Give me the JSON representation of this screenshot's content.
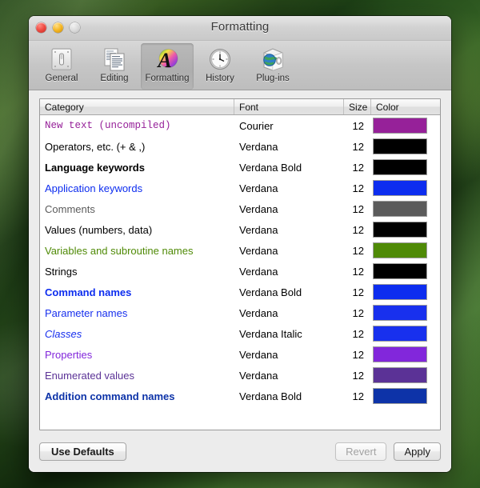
{
  "window": {
    "title": "Formatting",
    "traffic_lights": [
      "close",
      "minimize",
      "zoom"
    ]
  },
  "toolbar": {
    "items": [
      {
        "label": "General",
        "icon": "switch-icon",
        "selected": false
      },
      {
        "label": "Editing",
        "icon": "documents-icon",
        "selected": false
      },
      {
        "label": "Formatting",
        "icon": "color-a-icon",
        "selected": true
      },
      {
        "label": "History",
        "icon": "clock-icon",
        "selected": false
      },
      {
        "label": "Plug-ins",
        "icon": "globe-box-icon",
        "selected": false
      }
    ]
  },
  "table": {
    "columns": [
      "Category",
      "Font",
      "Size",
      "Color"
    ],
    "rows": [
      {
        "category": "New text (uncompiled)",
        "font": "Courier",
        "size": "12",
        "color": "#962199",
        "text_color": "#962199",
        "style": "mono"
      },
      {
        "category": "Operators, etc. (+ & ,)",
        "font": "Verdana",
        "size": "12",
        "color": "#000000",
        "text_color": "#000000",
        "style": "normal"
      },
      {
        "category": "Language keywords",
        "font": "Verdana Bold",
        "size": "12",
        "color": "#000000",
        "text_color": "#000000",
        "style": "bold"
      },
      {
        "category": "Application keywords",
        "font": "Verdana",
        "size": "12",
        "color": "#0D2DEF",
        "text_color": "#0D2DEF",
        "style": "normal"
      },
      {
        "category": "Comments",
        "font": "Verdana",
        "size": "12",
        "color": "#5B5B5B",
        "text_color": "#5B5B5B",
        "style": "normal"
      },
      {
        "category": "Values (numbers, data)",
        "font": "Verdana",
        "size": "12",
        "color": "#000000",
        "text_color": "#000000",
        "style": "normal"
      },
      {
        "category": "Variables and subroutine names",
        "font": "Verdana",
        "size": "12",
        "color": "#4F8A06",
        "text_color": "#4F8A06",
        "style": "normal"
      },
      {
        "category": "Strings",
        "font": "Verdana",
        "size": "12",
        "color": "#000000",
        "text_color": "#000000",
        "style": "normal"
      },
      {
        "category": "Command names",
        "font": "Verdana Bold",
        "size": "12",
        "color": "#0D2DEF",
        "text_color": "#0D2DEF",
        "style": "bold"
      },
      {
        "category": "Parameter names",
        "font": "Verdana",
        "size": "12",
        "color": "#1830EE",
        "text_color": "#1830EE",
        "style": "normal"
      },
      {
        "category": "Classes",
        "font": "Verdana Italic",
        "size": "12",
        "color": "#1830EE",
        "text_color": "#1830EE",
        "style": "italic"
      },
      {
        "category": "Properties",
        "font": "Verdana",
        "size": "12",
        "color": "#8227DB",
        "text_color": "#8227DB",
        "style": "normal"
      },
      {
        "category": "Enumerated values",
        "font": "Verdana",
        "size": "12",
        "color": "#5B3296",
        "text_color": "#5B3296",
        "style": "normal"
      },
      {
        "category": "Addition command names",
        "font": "Verdana Bold",
        "size": "12",
        "color": "#0D33A8",
        "text_color": "#0D33A8",
        "style": "bold"
      }
    ]
  },
  "buttons": {
    "use_defaults": "Use Defaults",
    "revert": "Revert",
    "apply": "Apply"
  }
}
